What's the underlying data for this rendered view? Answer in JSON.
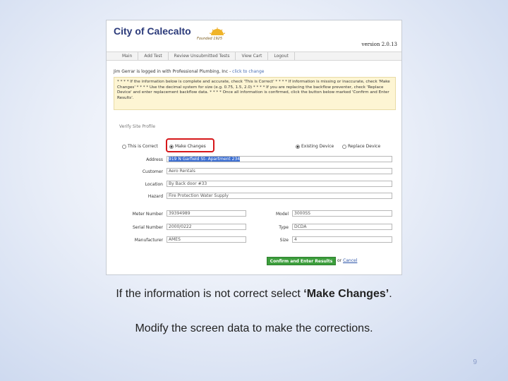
{
  "app": {
    "logo": "City of Calecalto",
    "founded": "Founded 1925",
    "version": "version 2.0.13"
  },
  "nav": [
    "Main",
    "Add Test",
    "Review Unsubmitted Tests",
    "View Cart",
    "Logout"
  ],
  "login": {
    "text": "Jim Gerrar is logged in with Professional Plumbing, Inc - ",
    "change_link": "click to change"
  },
  "note": "* * * * If the information below is complete and accurate, check 'This is Correct' * * * * If information is missing or inaccurate, check 'Make Changes' * * * * Use the decimal system for size (e.g. 0.75, 1.5, 2.0) * * * * If you are replacing the backflow preventer, check 'Replace Device' and enter replacement backflow data. * * * * Once all information is confirmed, click the button below marked 'Confirm and Enter Results'.",
  "form": {
    "section_title": "Verify Site Profile",
    "this_is_correct": "This is Correct",
    "make_changes": "Make Changes",
    "existing_device": "Existing Device",
    "replace_device": "Replace Device",
    "address_label": "Address",
    "address_value": "919 N Garfield St- Apartment 234",
    "customer_label": "Customer",
    "customer_value": "Aero Rentals",
    "location_label": "Location",
    "location_value": "By Back door #33",
    "hazard_label": "Hazard",
    "hazard_value": "Fire Protection Water Supply",
    "meter_label": "Meter Number",
    "meter_value": "39394989",
    "serial_label": "Serial Number",
    "serial_value": "2000/0222",
    "manufacturer_label": "Manufacturer",
    "manufacturer_value": "AMES",
    "model_label": "Model",
    "model_value": "3000SS",
    "type_label": "Type",
    "type_value": "DCDA",
    "size_label": "Size",
    "size_value": "4",
    "confirm_button": "Confirm and Enter Results",
    "or": "or",
    "cancel_link": "Cancel"
  },
  "captions": {
    "line1_start": "If the information is not correct select ",
    "line1_bold": "‘Make Changes’",
    "line1_end": ".",
    "line2": "Modify the screen data to make the corrections."
  },
  "page_number": "9",
  "colors": {
    "highlight": "#d6171a",
    "button": "#3c9e3c",
    "note_bg": "#fdf5d3",
    "logo": "#2b3a7a"
  }
}
